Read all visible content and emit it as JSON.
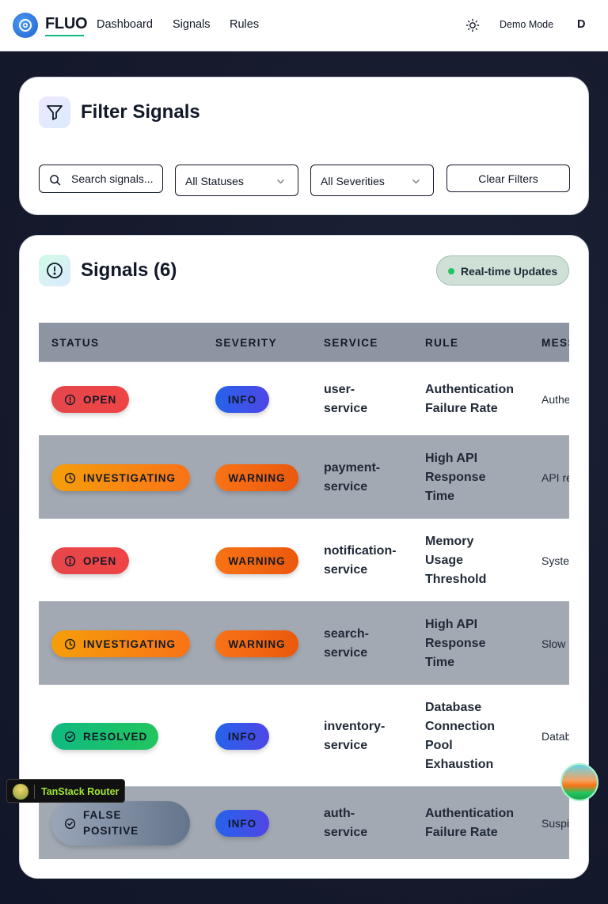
{
  "nav": {
    "brand": "FLUO",
    "links": [
      "Dashboard",
      "Signals",
      "Rules"
    ],
    "demo_mode": "Demo Mode",
    "user_initial": "D"
  },
  "filters": {
    "title": "Filter Signals",
    "search_placeholder": "Search signals...",
    "status_select": "All Statuses",
    "severity_select": "All Severities",
    "clear_button": "Clear Filters"
  },
  "signals": {
    "title": "Signals (6)",
    "realtime_label": "Real-time Updates",
    "columns": [
      "STATUS",
      "SEVERITY",
      "SERVICE",
      "RULE",
      "MESSAGE"
    ],
    "rows": [
      {
        "status": "OPEN",
        "severity": "INFO",
        "service": "user-\nservice",
        "rule": "Authentication\nFailure Rate",
        "message": "Authe"
      },
      {
        "status": "INVESTIGATING",
        "severity": "WARNING",
        "service": "payment-\nservice",
        "rule": "High API\nResponse\nTime",
        "message": "API re"
      },
      {
        "status": "OPEN",
        "severity": "WARNING",
        "service": "notification-\nservice",
        "rule": "Memory\nUsage\nThreshold",
        "message": "Syste"
      },
      {
        "status": "INVESTIGATING",
        "severity": "WARNING",
        "service": "search-\nservice",
        "rule": "High API\nResponse\nTime",
        "message": "Slow"
      },
      {
        "status": "RESOLVED",
        "severity": "INFO",
        "service": "inventory-\nservice",
        "rule": "Database\nConnection\nPool\nExhaustion",
        "message": "Datab"
      },
      {
        "status": "FALSE\nPOSITIVE",
        "severity": "INFO",
        "service": "auth-\nservice",
        "rule": "Authentication\nFailure Rate",
        "message": "Suspi"
      }
    ]
  },
  "devtools": {
    "router_label": "TanStack Router"
  },
  "colors": {
    "open": "#ef4444",
    "investigating": "#f97316",
    "resolved": "#22c55e",
    "false_positive": "#64748b",
    "info": "#2563eb",
    "warning": "#ea580c",
    "accent_underline": "#10b981"
  }
}
